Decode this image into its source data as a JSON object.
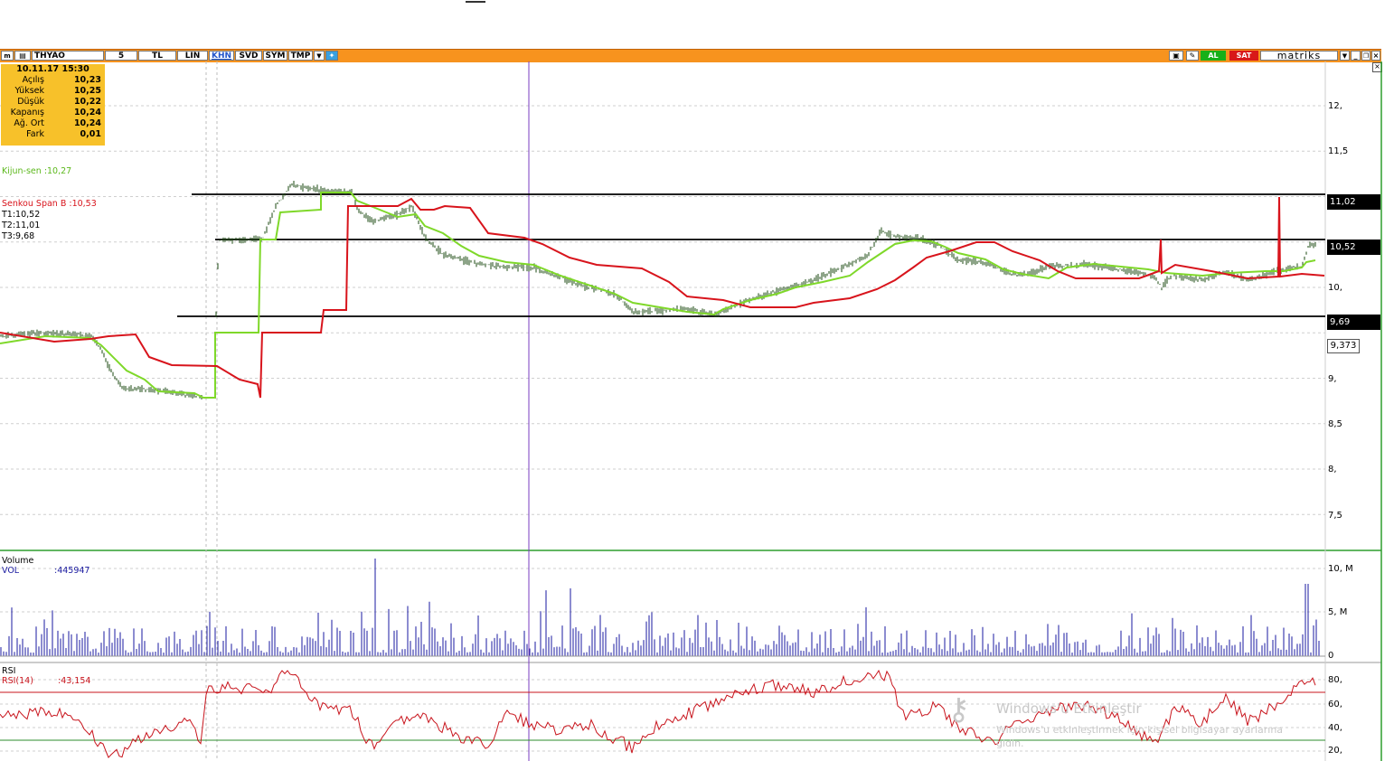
{
  "toolbar": {
    "symbol": "THYAO",
    "period": "5",
    "currency": "TL",
    "scale": "LIN",
    "buttons": [
      "KHN",
      "SVD",
      "SYM",
      "TMP"
    ],
    "buy_label": "AL",
    "sell_label": "SAT",
    "brand": "matriks",
    "accent": "#f7931e"
  },
  "ohlc": {
    "datetime": "10.11.17 15:30",
    "rows": [
      {
        "label": "Açılış",
        "value": "10,23"
      },
      {
        "label": "Yüksek",
        "value": "10,25"
      },
      {
        "label": "Düşük",
        "value": "10,22"
      },
      {
        "label": "Kapanış",
        "value": "10,24"
      },
      {
        "label": "Ağ. Ort",
        "value": "10,24"
      },
      {
        "label": "Fark",
        "value": "0,01"
      }
    ]
  },
  "indicators": {
    "kijun": "Kijun-sen    :10,27",
    "senkou": "Senkou Span B  :10,53",
    "t1": "T1:10,52",
    "t2": "T2:11,01",
    "t3": "T3:9,68"
  },
  "price_axis": {
    "ticks": [
      "12,",
      "11,5",
      "11,02",
      "10,52",
      "10,",
      "9,69",
      "9,373",
      "9,",
      "8,5",
      "8,",
      "7,5"
    ],
    "tags": [
      "11,02",
      "10,52",
      "9,69"
    ],
    "cursor_value": "9,373"
  },
  "volume_panel": {
    "title": "Volume",
    "label": "VOL",
    "value": ":445947",
    "ticks": [
      "10, M",
      "5, M",
      "0"
    ]
  },
  "rsi_panel": {
    "title": "RSI",
    "label": "RSI(14)",
    "value": ":43,154",
    "ticks": [
      "80,",
      "60,",
      "40,",
      "20,"
    ]
  },
  "watermark": {
    "title": "Windows'u Etkinleştir",
    "line1": "Windows'u etkinleştirmek için kişisel bilgisayar ayarlarına",
    "line2": "gidin."
  },
  "colors": {
    "kijun_line": "#7fd82a",
    "senkou_line": "#d8141c",
    "candles": "#1b4a10",
    "volume_bars": "#1a1aa0",
    "rsi_line": "#c8141c",
    "panel_border": "#2e9e2e"
  }
}
